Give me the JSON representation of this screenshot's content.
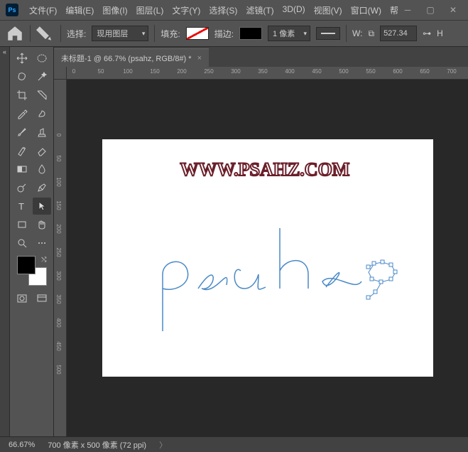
{
  "titlebar": {
    "app": "Ps",
    "menus": [
      "文件(F)",
      "编辑(E)",
      "图像(I)",
      "图层(L)",
      "文字(Y)",
      "选择(S)",
      "滤镜(T)",
      "3D(D)",
      "视图(V)",
      "窗口(W)",
      "帮"
    ]
  },
  "options": {
    "select_label": "选择:",
    "select_value": "现用图层",
    "fill_label": "填充:",
    "stroke_label": "描边:",
    "stroke_width": "1 像素",
    "w_label": "W:",
    "w_value": "527.34",
    "h_label": "H"
  },
  "tab": {
    "title": "未标题-1 @ 66.7% (psahz, RGB/8#) *"
  },
  "ruler_h": [
    "0",
    "50",
    "100",
    "150",
    "200",
    "250",
    "300",
    "350",
    "400",
    "450",
    "500",
    "550",
    "600",
    "650",
    "700"
  ],
  "ruler_v": [
    "0",
    "50",
    "100",
    "150",
    "200",
    "250",
    "300",
    "350",
    "400",
    "450",
    "500"
  ],
  "canvas": {
    "watermark": "WWW.PSAHZ.COM"
  },
  "status": {
    "zoom": "66.67%",
    "doc_info": "700 像素 x 500 像素 (72 ppi)"
  },
  "tools": [
    [
      "move-tool",
      "ellipse-marquee-tool"
    ],
    [
      "lasso-tool",
      "magic-wand-tool"
    ],
    [
      "crop-tool",
      "slice-tool"
    ],
    [
      "eyedropper-tool",
      "healing-brush-tool"
    ],
    [
      "brush-tool",
      "clone-stamp-tool"
    ],
    [
      "history-brush-tool",
      "eraser-tool"
    ],
    [
      "gradient-tool",
      "blur-tool"
    ],
    [
      "dodge-tool",
      "pen-tool"
    ],
    [
      "type-tool",
      "path-select-tool"
    ],
    [
      "rectangle-tool",
      "hand-tool"
    ],
    [
      "zoom-tool",
      "edit-toolbar"
    ]
  ]
}
